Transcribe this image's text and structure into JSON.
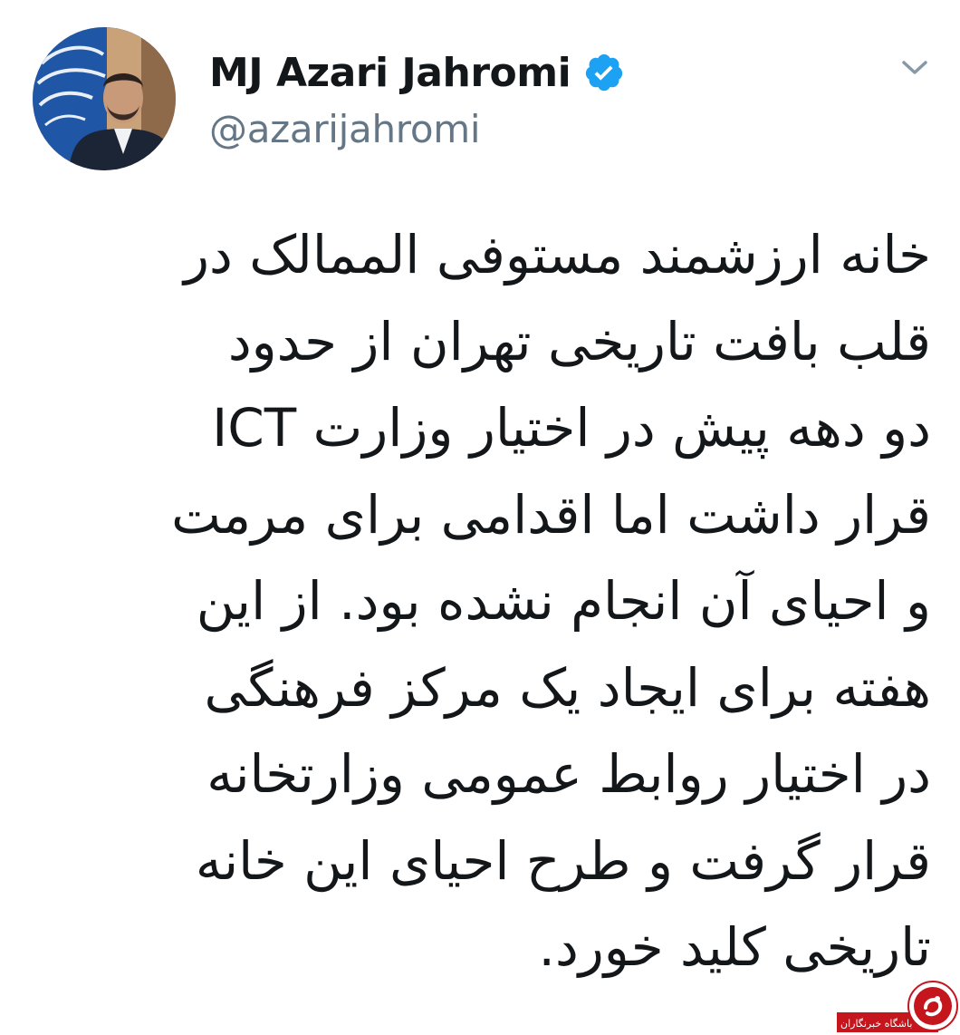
{
  "author": {
    "display_name": "MJ Azari Jahromi",
    "handle": "@azarijahromi",
    "verified_icon": "verified-badge-icon",
    "avatar_icon": "profile-avatar"
  },
  "menu": {
    "caret_icon": "chevron-down-icon"
  },
  "tweet": {
    "lines": [
      "خانه ارزشمند مستوفی الممالک در",
      "قلب بافت تاریخی تهران از حدود",
      "دو دهه پیش در اختیار وزارت ICT",
      "قرار داشت اما اقدامی برای مرمت",
      "و احیای آن انجام نشده بود. از این",
      "هفته برای ایجاد یک مرکز فرهنگی",
      "در اختیار روابط عمومی وزارتخانه",
      "قرار گرفت و طرح احیای این خانه",
      "تاریخی کلید خورد."
    ]
  },
  "watermark": {
    "text": "باشگاه خبرنگاران"
  },
  "colors": {
    "text": "#14171a",
    "handle": "#657786",
    "verified": "#1da1f2",
    "watermark": "#c4161c"
  }
}
